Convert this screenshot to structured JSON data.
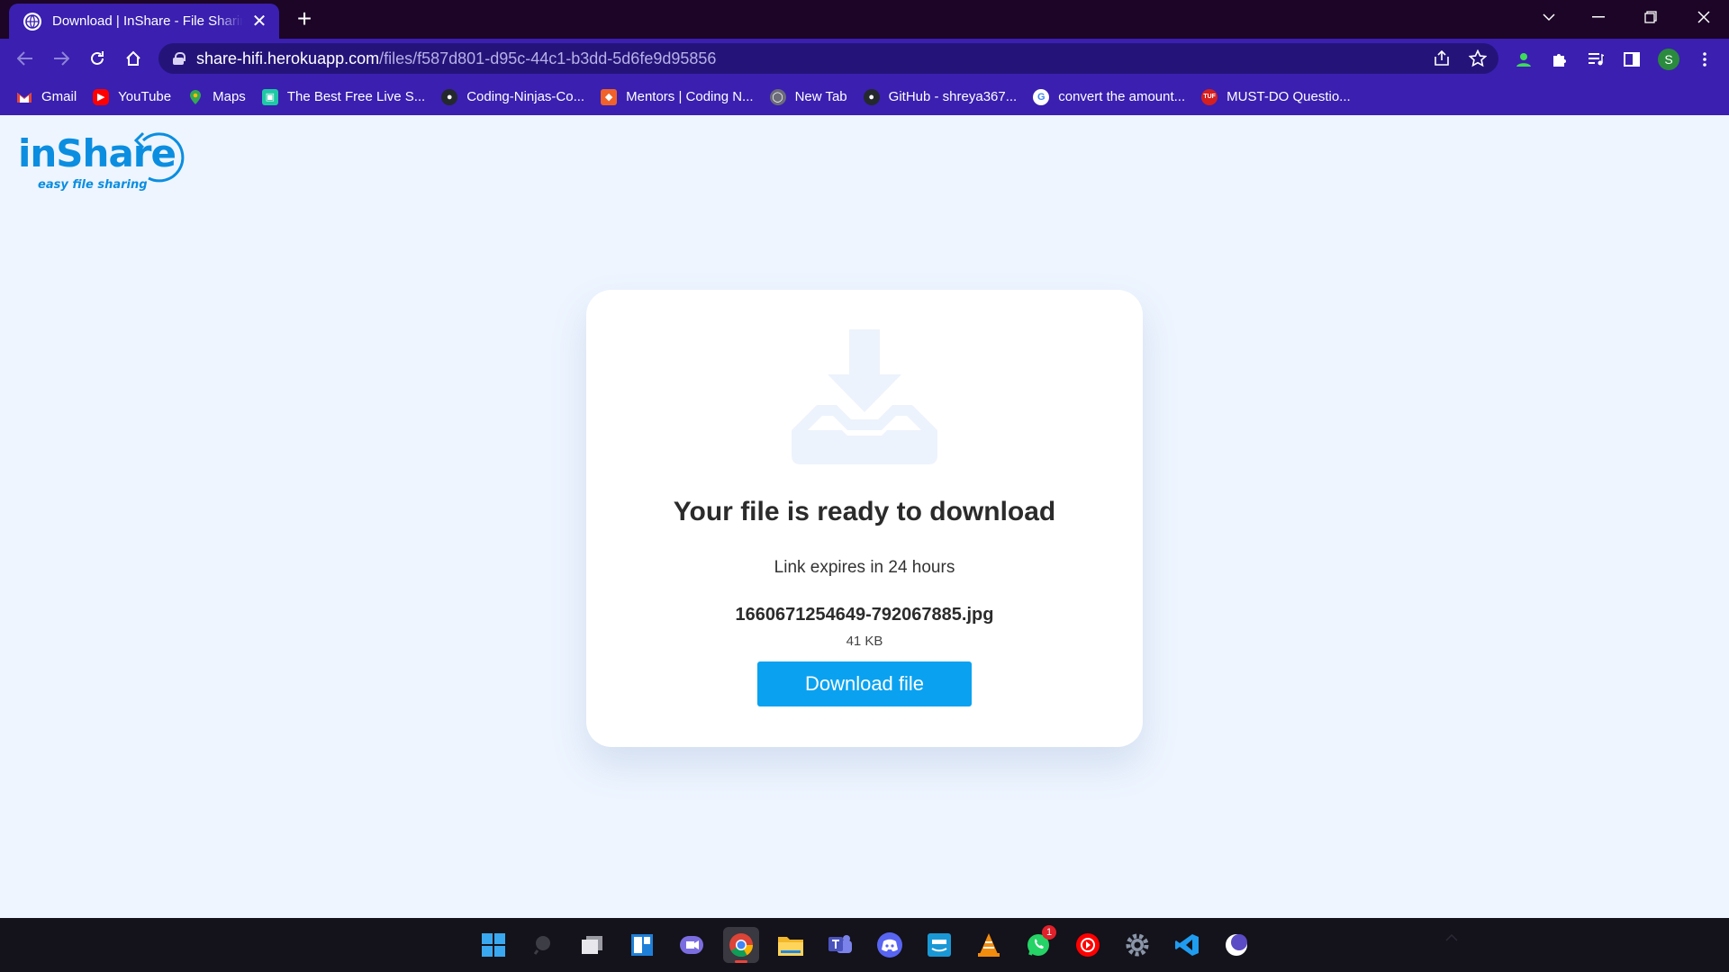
{
  "browser": {
    "tab_title": "Download | InShare - File Sharing",
    "tab_close": "✕",
    "new_tab": "+",
    "url_host": "share-hifi.herokuapp.com",
    "url_path": "/files/f587d801-d95c-44c1-b3dd-5d6fe9d95856",
    "profile_initial": "S",
    "bookmarks": [
      {
        "label": "Gmail",
        "icon": "gmail-icon",
        "color": "#ea4335"
      },
      {
        "label": "YouTube",
        "icon": "youtube-icon",
        "color": "#ff0000"
      },
      {
        "label": "Maps",
        "icon": "maps-icon",
        "color": "#34a853"
      },
      {
        "label": "The Best Free Live S...",
        "icon": "chat-icon",
        "color": "#1ec8a5"
      },
      {
        "label": "Coding-Ninjas-Co...",
        "icon": "github-icon",
        "color": "#24292e"
      },
      {
        "label": "Mentors | Coding N...",
        "icon": "coding-ninjas-icon",
        "color": "#f0622a"
      },
      {
        "label": "New Tab",
        "icon": "globe-icon",
        "color": "#6b6b7a"
      },
      {
        "label": "GitHub - shreya367...",
        "icon": "github-icon",
        "color": "#24292e"
      },
      {
        "label": "convert the amount...",
        "icon": "google-icon",
        "color": "#ffffff"
      },
      {
        "label": "MUST-DO Questio...",
        "icon": "tuf-icon",
        "color": "#d61f1f"
      }
    ]
  },
  "logo": {
    "name": "inShare",
    "tagline": "easy file sharing"
  },
  "card": {
    "title": "Your file is ready to download",
    "expiry": "Link expires in 24 hours",
    "file_name": "1660671254649-792067885.jpg",
    "file_size": "41 KB",
    "download_label": "Download file"
  },
  "colors": {
    "accent": "#0aa2f0",
    "chrome": "#3a1fb0",
    "page_bg": "#eef5ff"
  },
  "taskbar": {
    "whatsapp_badge": "1"
  }
}
